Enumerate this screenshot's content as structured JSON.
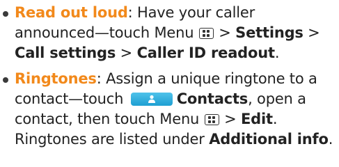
{
  "accent_color": "#f2891b",
  "contacts_button_color": "#2aaee0",
  "items": [
    {
      "term": "Read out loud",
      "colon": ":",
      "text1": " Have your caller announced—touch Menu ",
      "menu_icon": "menu-key-icon",
      "sep1": " > ",
      "settings": "Settings",
      "sep2": " > ",
      "call_settings": "Call settings",
      "sep3": " > ",
      "caller_id": "Caller ID readout",
      "end": "."
    },
    {
      "term": "Ringtones",
      "colon": ":",
      "text1": " Assign a unique ringtone to a contact—touch ",
      "contacts_icon": "contacts-person-icon",
      "contacts": "Contacts",
      "text2": ", open a contact, then touch Menu ",
      "menu_icon": "menu-key-icon",
      "sep1": " > ",
      "edit": "Edit",
      "text3": ". Ringtones are listed under ",
      "additional_info": "Additional info",
      "end": "."
    }
  ]
}
